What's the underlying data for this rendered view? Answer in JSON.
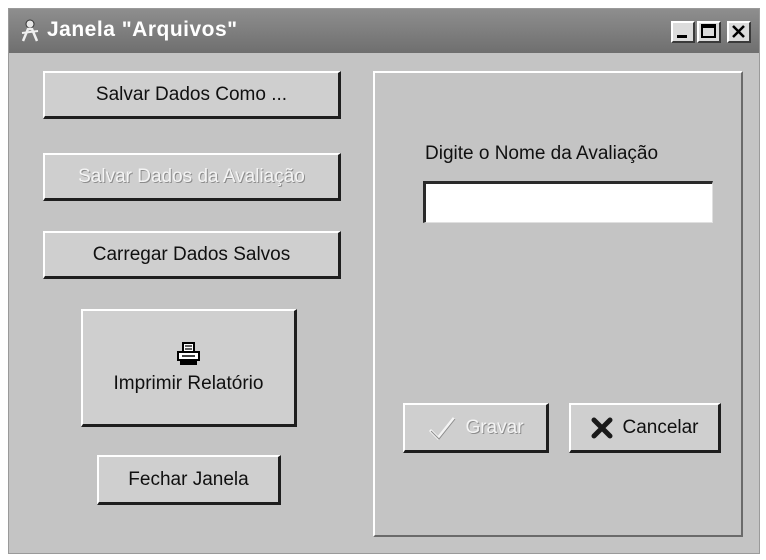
{
  "window": {
    "title": "Janela \"Arquivos\"",
    "controls": {
      "minimize_icon": "minimize-icon",
      "maximize_icon": "maximize-icon",
      "close_icon": "close-icon"
    }
  },
  "actions": {
    "save_as_label": "Salvar Dados Como ...",
    "save_evaluation_label": "Salvar Dados da Avaliação",
    "load_label": "Carregar Dados Salvos",
    "print_label": "Imprimir Relatório",
    "close_window_label": "Fechar Janela"
  },
  "form": {
    "prompt": "Digite o Nome da Avaliação",
    "name_value": "",
    "save_label": "Gravar",
    "cancel_label": "Cancelar"
  },
  "icons": {
    "app": "app-icon",
    "printer": "printer-icon",
    "checkmark": "checkmark-icon",
    "cancel": "x-icon"
  },
  "colors": {
    "window_bg": "#c4c4c4",
    "titlebar": "#7a7a7a",
    "cancel_x": "#1a1a1a",
    "disabled_text": "#f4f4f4"
  }
}
